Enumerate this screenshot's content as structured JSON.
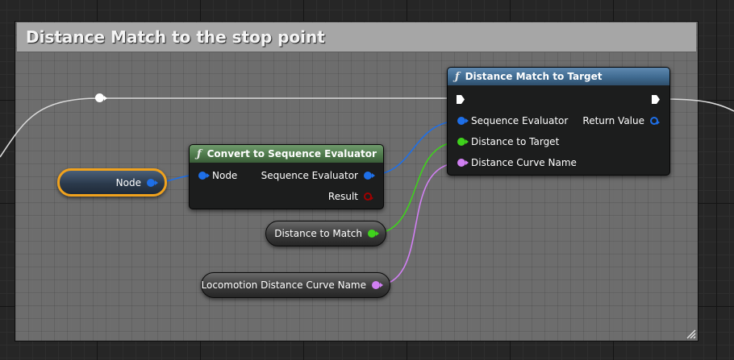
{
  "comment": {
    "title": "Distance Match to the stop point"
  },
  "nodes": {
    "distance_match": {
      "title": "Distance Match to Target",
      "icon": "function-icon",
      "inputs": [
        {
          "label": "Sequence Evaluator",
          "color": "#1e6fe8"
        },
        {
          "label": "Distance to Target",
          "color": "#3fd21c"
        },
        {
          "label": "Distance Curve Name",
          "color": "#d07ff2"
        }
      ],
      "output": {
        "label": "Return Value",
        "color": "#1e6fe8"
      }
    },
    "convert": {
      "title": "Convert to Sequence Evaluator",
      "icon": "function-icon",
      "input": {
        "label": "Node",
        "color": "#1e6fe8"
      },
      "outputs": [
        {
          "label": "Sequence Evaluator",
          "color": "#1e6fe8"
        },
        {
          "label": "Result",
          "color": "#a00000"
        }
      ]
    }
  },
  "variables": {
    "node": {
      "label": "Node",
      "color": "#1e6fe8"
    },
    "distance_to_match": {
      "label": "Distance to Match",
      "color": "#3fd21c"
    },
    "curve_name": {
      "label": "Locomotion Distance Curve Name",
      "color": "#d07ff2"
    }
  },
  "colors": {
    "exec_wire": "#d9d9d9",
    "selection": "#f0a21d"
  }
}
